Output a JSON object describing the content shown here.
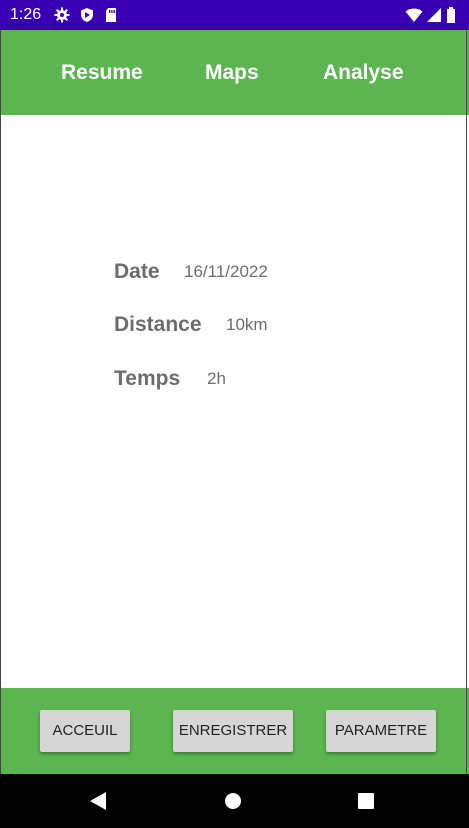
{
  "status_bar": {
    "time": "1:26",
    "bg_color": "#3700b3",
    "left_icons": [
      "gear-icon",
      "shield-icon",
      "sd-card-icon"
    ],
    "right_icons": [
      "wifi-icon",
      "signal-icon",
      "battery-icon"
    ]
  },
  "app_bar": {
    "bg_color": "#5db552",
    "tabs": [
      {
        "label": "Resume"
      },
      {
        "label": "Maps"
      },
      {
        "label": "Analyse"
      }
    ]
  },
  "details": {
    "date": {
      "label": "Date",
      "value": "16/11/2022"
    },
    "distance": {
      "label": "Distance",
      "value": "10km"
    },
    "temps": {
      "label": "Temps",
      "value": "2h"
    }
  },
  "bottom_bar": {
    "bg_color": "#5db552",
    "buttons": [
      {
        "label": "ACCEUIL"
      },
      {
        "label": "ENREGISTRER"
      },
      {
        "label": "PARAMETRE"
      }
    ]
  },
  "nav_bar": {
    "buttons": [
      "back-icon",
      "home-icon",
      "recents-icon"
    ]
  }
}
